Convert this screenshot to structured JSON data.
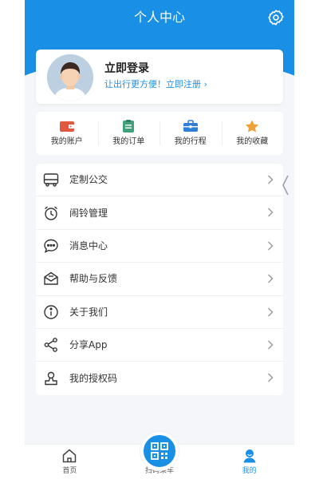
{
  "colors": {
    "brand": "#1a8fe6",
    "background": "#f4f6f9"
  },
  "header": {
    "title": "个人中心",
    "settings_icon": "gear-icon"
  },
  "profile": {
    "login_title": "立即登录",
    "login_subtitle": "让出行更方便！立即注册 ›",
    "avatar": "user-avatar"
  },
  "quick_actions": [
    {
      "label": "我的账户",
      "icon": "wallet-icon"
    },
    {
      "label": "我的订单",
      "icon": "order-icon"
    },
    {
      "label": "我的行程",
      "icon": "briefcase-icon"
    },
    {
      "label": "我的收藏",
      "icon": "star-icon"
    }
  ],
  "menu": [
    {
      "label": "定制公交",
      "icon": "bus-icon"
    },
    {
      "label": "闹铃管理",
      "icon": "alarm-icon"
    },
    {
      "label": "消息中心",
      "icon": "message-icon"
    },
    {
      "label": "帮助与反馈",
      "icon": "feedback-icon"
    },
    {
      "label": "关于我们",
      "icon": "info-icon"
    },
    {
      "label": "分享App",
      "icon": "share-icon"
    },
    {
      "label": "我的授权码",
      "icon": "authcode-icon"
    }
  ],
  "tabbar": {
    "home": "首页",
    "scan": "扫码乘车",
    "mine": "我的"
  }
}
